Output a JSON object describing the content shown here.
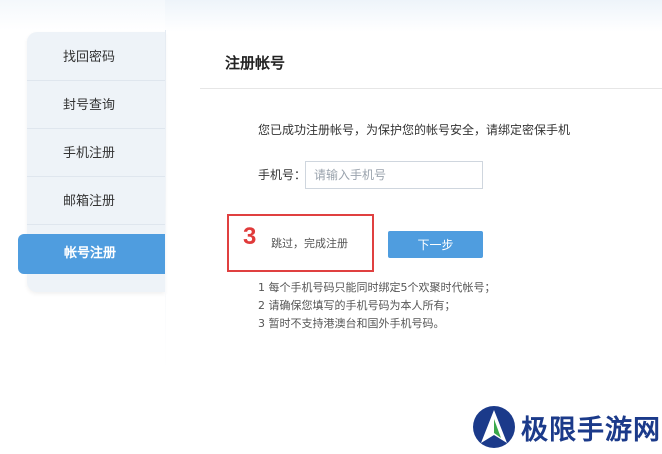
{
  "sidebar": {
    "items": [
      {
        "label": "找回密码"
      },
      {
        "label": "封号查询"
      },
      {
        "label": "手机注册"
      },
      {
        "label": "邮箱注册"
      },
      {
        "label": "帐号注册",
        "active": true
      }
    ]
  },
  "main": {
    "title": "注册帐号",
    "notice": "您已成功注册帐号，为保护您的帐号安全，请绑定密保手机",
    "phone_label": "手机号：",
    "phone_placeholder": "请输入手机号",
    "phone_value": "",
    "step_number": "3",
    "skip_label": "跳过，完成注册",
    "next_label": "下一步",
    "tips": [
      "1 每个手机号码只能同时绑定5个欢聚时代帐号；",
      "2 请确保您填写的手机号码为本人所有；",
      "3 暂时不支持港澳台和国外手机号码。"
    ]
  },
  "watermark": {
    "text": "极限手游网"
  },
  "colors": {
    "accent": "#4f9ddf",
    "highlight_red": "#e04040",
    "sidebar_bg": "#eef3f8",
    "watermark_blue": "#1b3a8a",
    "watermark_green": "#3aa84a"
  }
}
